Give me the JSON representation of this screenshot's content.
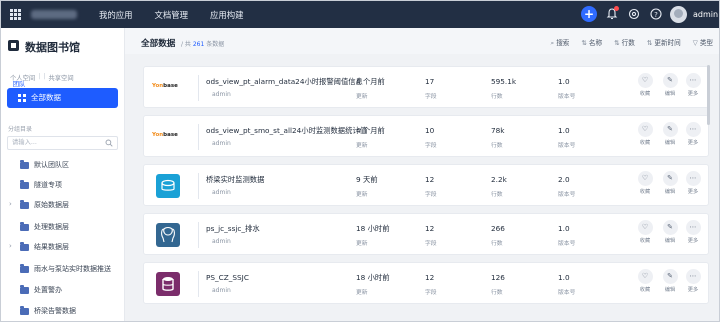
{
  "topbar": {
    "nav": [
      "我的应用",
      "文档管理",
      "应用构建"
    ],
    "user": "admin"
  },
  "sidebar": {
    "title": "数据图书馆",
    "space_tabs": [
      "个人空间",
      "团队空间",
      "共享空间"
    ],
    "active_space": 1,
    "all_data_label": "全部数据",
    "category_label": "分组目录",
    "search_placeholder": "请输入...",
    "tree": [
      {
        "label": "默认团队区",
        "expandable": false
      },
      {
        "label": "隧道专项",
        "expandable": false
      },
      {
        "label": "原始数据层",
        "expandable": true
      },
      {
        "label": "处理数据层",
        "expandable": false
      },
      {
        "label": "结果数据层",
        "expandable": true
      },
      {
        "label": "雨水与泵站实时数据推送",
        "expandable": false
      },
      {
        "label": "处置警办",
        "expandable": false
      },
      {
        "label": "桥梁告警数据",
        "expandable": false
      }
    ]
  },
  "main": {
    "title": "全部数据",
    "count_prefix": "/ 共",
    "count": "261",
    "count_suffix": "条数据",
    "controls": [
      "搜索",
      "名称",
      "行数",
      "更新时间",
      "类型"
    ],
    "stat_labels": {
      "updated": "更新",
      "fields": "字段",
      "rows": "行数",
      "version": "版本号"
    },
    "action_labels": [
      "收藏",
      "编辑",
      "更多"
    ],
    "rows": [
      {
        "name": "ods_view_pt_alarm_data24小时报警阈值信息",
        "owner": "admin",
        "updated": "4 个月前",
        "fields": "17",
        "rows": "595.1k",
        "version": "1.0",
        "logo": "text"
      },
      {
        "name": "ods_view_pt_smo_st_all24小时监测数据统计值",
        "owner": "admin",
        "updated": "4 个月前",
        "fields": "10",
        "rows": "78k",
        "version": "1.0",
        "logo": "text"
      },
      {
        "name": "桥梁实时监测数据",
        "owner": "admin",
        "updated": "9 天前",
        "fields": "12",
        "rows": "2.2k",
        "version": "2.0",
        "logo": "sql"
      },
      {
        "name": "ps_jc_ssjc_排水",
        "owner": "admin",
        "updated": "18 小时前",
        "fields": "12",
        "rows": "266",
        "version": "1.0",
        "logo": "postgres"
      },
      {
        "name": "PS_CZ_SSJC",
        "owner": "admin",
        "updated": "18 小时前",
        "fields": "12",
        "rows": "126",
        "version": "1.0",
        "logo": "db"
      }
    ],
    "logo_text": {
      "prefix": "Yon",
      "suffix": "base"
    }
  },
  "colors": {
    "accent": "#1e5cff",
    "topbar": "#222f44"
  }
}
